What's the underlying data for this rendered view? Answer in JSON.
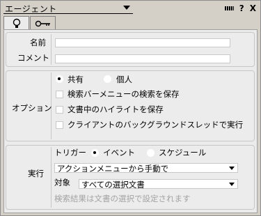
{
  "window": {
    "title": "エージェント",
    "icons": {
      "grip": "grip-icon",
      "help": "?",
      "close": "X"
    }
  },
  "tabs": [
    {
      "icon": "lightbulb-icon",
      "active": true
    },
    {
      "icon": "key-icon",
      "active": false
    }
  ],
  "general": {
    "name_label": "名前",
    "comment_label": "コメント",
    "name_value": "",
    "comment_value": ""
  },
  "options": {
    "section_label": "オプション",
    "radio_shared": "共有",
    "radio_personal": "個人",
    "selected": "共有",
    "checkboxes": [
      {
        "label": "検索バーメニューの検索を保存",
        "checked": false
      },
      {
        "label": "文書中のハイライトを保存",
        "checked": false
      },
      {
        "label": "クライアントのバックグラウンドスレッドで実行",
        "checked": false
      }
    ]
  },
  "run": {
    "section_label": "実行",
    "trigger_label": "トリガー",
    "trigger_event": "イベント",
    "trigger_schedule": "スケジュール",
    "trigger_selected": "イベント",
    "trigger_select_value": "アクションメニューから手動で",
    "target_label": "対象",
    "target_select_value": "すべての選択文書",
    "hint": "検索結果は文書の選択で設定されます"
  }
}
